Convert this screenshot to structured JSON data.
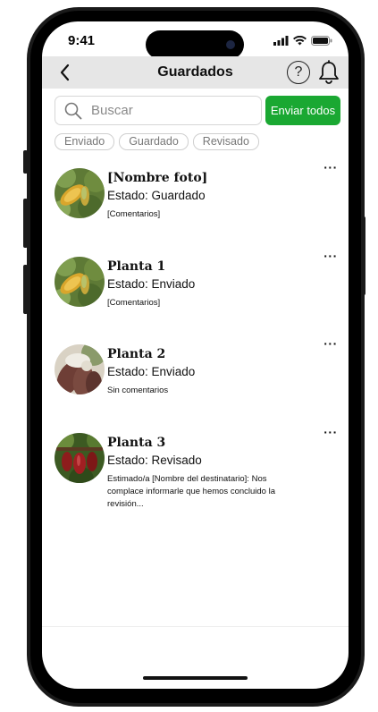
{
  "status_bar": {
    "time": "9:41"
  },
  "header": {
    "title": "Guardados",
    "help_label": "?"
  },
  "search": {
    "placeholder": "Buscar"
  },
  "actions": {
    "send_all_label": "Enviar todos"
  },
  "filters": [
    {
      "label": "Enviado"
    },
    {
      "label": "Guardado"
    },
    {
      "label": "Revisado"
    }
  ],
  "items": [
    {
      "title": "[Nombre foto]",
      "state": "Estado: Guardado",
      "comment": "[Comentarios]",
      "more": "···"
    },
    {
      "title": "Planta 1",
      "state": "Estado: Enviado",
      "comment": "[Comentarios]",
      "more": "···"
    },
    {
      "title": "Planta 2",
      "state": "Estado: Enviado",
      "comment": "Sin comentarios",
      "more": "···"
    },
    {
      "title": "Planta 3",
      "state": "Estado: Revisado",
      "comment": "Estimado/a [Nombre del destinatario]: Nos complace informarle que hemos concluido la revisión...",
      "more": "···"
    }
  ],
  "colors": {
    "accent": "#1aa832",
    "navbar": "#e6e6e6",
    "phone_frame": "#1a1a1a"
  },
  "icons": {
    "back": "chevron-left-icon",
    "help": "help-circle-icon",
    "notifications": "bell-icon",
    "search": "search-icon",
    "more": "more-horizontal-icon"
  }
}
